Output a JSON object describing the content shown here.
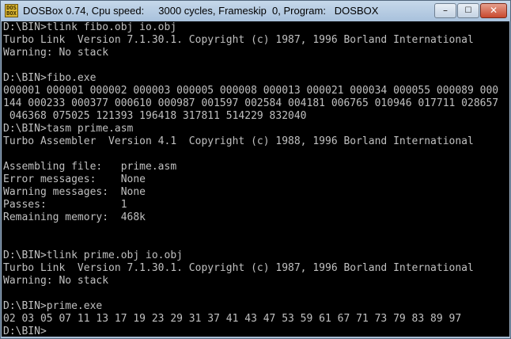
{
  "window": {
    "icon_label": "DOS BOX",
    "title": "DOSBox 0.74, Cpu speed:     3000 cycles, Frameskip  0, Program:   DOSBOX",
    "controls": {
      "minimize": "–",
      "maximize": "☐",
      "close": "✕"
    }
  },
  "console": {
    "lines": [
      "D:\\BIN>tlink fibo.obj io.obj",
      "Turbo Link  Version 7.1.30.1. Copyright (c) 1987, 1996 Borland International",
      "Warning: No stack",
      "",
      "D:\\BIN>fibo.exe",
      "000001 000001 000002 000003 000005 000008 000013 000021 000034 000055 000089 000",
      "144 000233 000377 000610 000987 001597 002584 004181 006765 010946 017711 028657",
      " 046368 075025 121393 196418 317811 514229 832040",
      "D:\\BIN>tasm prime.asm",
      "Turbo Assembler  Version 4.1  Copyright (c) 1988, 1996 Borland International",
      "",
      "Assembling file:   prime.asm",
      "Error messages:    None",
      "Warning messages:  None",
      "Passes:            1",
      "Remaining memory:  468k",
      "",
      "",
      "D:\\BIN>tlink prime.obj io.obj",
      "Turbo Link  Version 7.1.30.1. Copyright (c) 1987, 1996 Borland International",
      "Warning: No stack",
      "",
      "D:\\BIN>prime.exe",
      "02 03 05 07 11 13 17 19 23 29 31 37 41 43 47 53 59 61 67 71 73 79 83 89 97",
      "D:\\BIN>"
    ]
  }
}
